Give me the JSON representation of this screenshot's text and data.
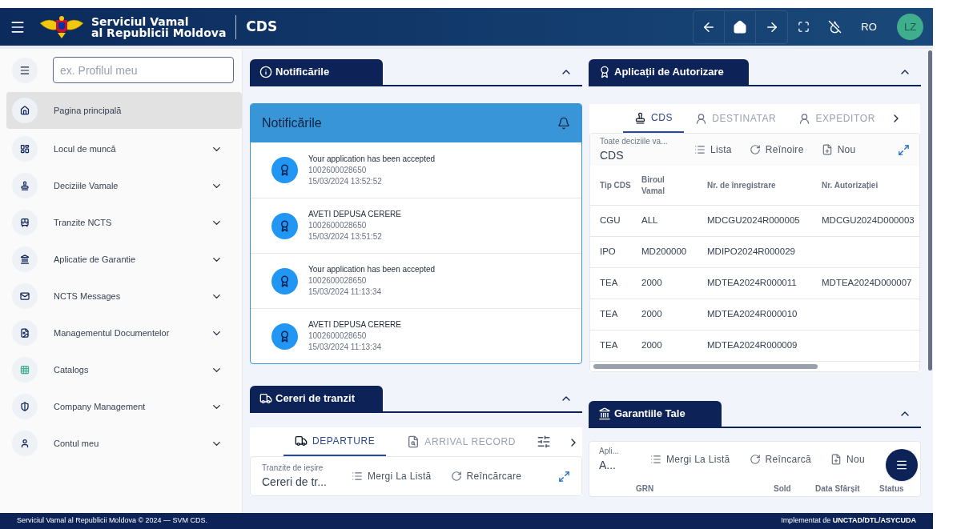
{
  "header": {
    "brand_line1": "Serviciul Vamal",
    "brand_line2": "al Republicii Moldova",
    "app": "CDS",
    "language": "RO",
    "avatar": "LZ"
  },
  "sidebar": {
    "search_placeholder": "ex. Profilul meu",
    "items": [
      {
        "label": "Pagina principală",
        "selected": true,
        "expandable": false
      },
      {
        "label": "Locul de muncă",
        "selected": false,
        "expandable": true
      },
      {
        "label": "Deciziile Vamale",
        "selected": false,
        "expandable": true
      },
      {
        "label": "Tranzite NCTS",
        "selected": false,
        "expandable": true
      },
      {
        "label": "Aplicatie de Garantie",
        "selected": false,
        "expandable": true
      },
      {
        "label": "NCTS Messages",
        "selected": false,
        "expandable": true
      },
      {
        "label": "Managementul Documentelor",
        "selected": false,
        "expandable": true
      },
      {
        "label": "Catalogs",
        "selected": false,
        "expandable": true
      },
      {
        "label": "Company Management",
        "selected": false,
        "expandable": true
      },
      {
        "label": "Contul meu",
        "selected": false,
        "expandable": true
      }
    ]
  },
  "notifications": {
    "title": "Notificările",
    "card_title": "Notificările",
    "items": [
      {
        "message": "Your application has been accepted",
        "number": "1002600028650",
        "time": "15/03/2024 13:52:52"
      },
      {
        "message": "AVETI DEPUSA CERERE",
        "number": "1002600028650",
        "time": "15/03/2024 13:51:52"
      },
      {
        "message": "Your application has been accepted",
        "number": "1002600028650",
        "time": "15/03/2024 11:13:34"
      },
      {
        "message": "AVETI DEPUSA CERERE",
        "number": "1002600028650",
        "time": "15/03/2024 11:13:34"
      }
    ]
  },
  "authorizations": {
    "title": "Aplicații de Autorizare",
    "tabs": [
      {
        "label": "CDS",
        "selected": true
      },
      {
        "label": "DESTINATAR",
        "selected": false
      },
      {
        "label": "EXPEDITOR",
        "selected": false
      }
    ],
    "filter": {
      "label": "Toate deciziile va...",
      "value": "CDS"
    },
    "actions": [
      "Lista",
      "Reînoire",
      "Nou"
    ],
    "columns": [
      "Tip CDS",
      "Biroul Vamal",
      "Nr. de înregistrare",
      "Nr. Autorizației"
    ],
    "rows": [
      [
        "CGU",
        "ALL",
        "MDCGU2024R000005",
        "MDCGU2024D000003"
      ],
      [
        "IPO",
        "MD200000",
        "MDIPO2024R000029",
        ""
      ],
      [
        "TEA",
        "2000",
        "MDTEA2024R000011",
        "MDTEA2024D000007"
      ],
      [
        "TEA",
        "2000",
        "MDTEA2024R000010",
        ""
      ],
      [
        "TEA",
        "2000",
        "MDTEA2024R000009",
        ""
      ]
    ]
  },
  "transits": {
    "title": "Cereri de tranzit",
    "tabs": [
      {
        "label": "DEPARTURE",
        "selected": true
      },
      {
        "label": "ARRIVAL RECORD",
        "selected": false
      }
    ],
    "filter": {
      "label": "Tranzite de ieșire",
      "value": "Cereri de tr..."
    },
    "actions": [
      "Mergi La Listă",
      "Reîncărcare"
    ]
  },
  "guarantees": {
    "title": "Garantiile Tale",
    "filter": {
      "label": "Apli...",
      "value": "A..."
    },
    "actions": [
      "Mergi La Listă",
      "Reîncarcă",
      "Nou"
    ],
    "columns": [
      "GRN",
      "Sold",
      "Data Sfârșit",
      "Status"
    ]
  },
  "footer": {
    "left": "Serviciul Vamal al Republicii Moldova © 2024 — SVM CDS.",
    "right": "Implementat de **UNCTAD/DTL/ASYCUDA**"
  }
}
